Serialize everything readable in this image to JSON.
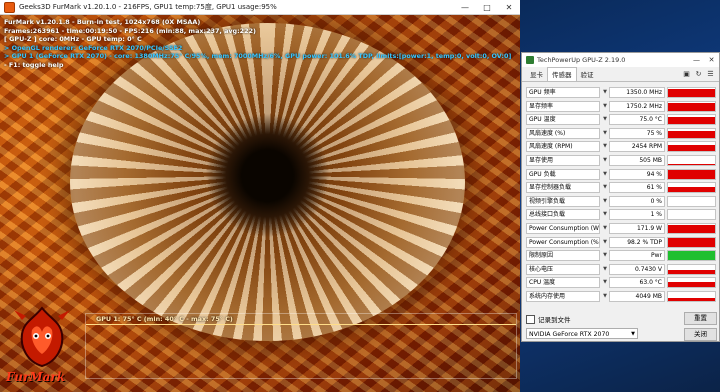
{
  "furmark": {
    "window_title": "Geeks3D FurMark v1.20.1.0 - 216FPS, GPU1 temp:75度, GPU1 usage:95%",
    "hud": [
      {
        "text": "FurMark v1.20.1.8 - Burn-in test, 1024x768 (0X MSAA)",
        "color": "white"
      },
      {
        "text": "Frames:263961 - time:00:19:50 - FPS:216 (min:88, max:237, avg:222)",
        "color": "white"
      },
      {
        "text": "[ GPU-Z ] core: 0MHz - GPU temp: 0° C",
        "color": "white"
      },
      {
        "text": "> OpenGL renderer: GeForce RTX 2070/PCIe/SSE2",
        "color": "cyan"
      },
      {
        "text": "> GPU 1 (GeForce RTX 2070) - core: 1380MHz:75° C/95%, mem: 7000MHz/6%, GPU power: 101.6% TDP, limits:[power:1, temp:0, volt:0, OV:0]",
        "color": "cyan"
      },
      {
        "text": "- F1: toggle help",
        "color": "white"
      }
    ],
    "graph_label": "GPU 1: 75° C (min: 40° C - max: 75° C)",
    "logo_text": "FurMark",
    "accent": "#e85b10"
  },
  "gpuz": {
    "window_title": "TechPowerUp GPU-Z 2.19.0",
    "tabs": [
      {
        "label": "显卡",
        "active": false
      },
      {
        "label": "传感器",
        "active": true
      },
      {
        "label": "验证",
        "active": false
      }
    ],
    "tool_icons": [
      "camera-icon",
      "refresh-icon",
      "menu-icon"
    ],
    "sensors": [
      {
        "label": "GPU 频率",
        "value": "1350.0 MHz",
        "fill": 0.85,
        "color": "#e00000"
      },
      {
        "label": "显存频率",
        "value": "1750.2 MHz",
        "fill": 0.9,
        "color": "#e00000"
      },
      {
        "label": "GPU 温度",
        "value": "75.0 °C",
        "fill": 0.75,
        "color": "#e00000"
      },
      {
        "label": "风扇速度 (%)",
        "value": "75 %",
        "fill": 0.75,
        "color": "#e00000"
      },
      {
        "label": "风扇速度 (RPM)",
        "value": "2454 RPM",
        "fill": 0.7,
        "color": "#e00000"
      },
      {
        "label": "显存使用",
        "value": "505 MB",
        "fill": 0.06,
        "color": "#e00000"
      },
      {
        "label": "GPU 负载",
        "value": "94 %",
        "fill": 0.94,
        "color": "#e00000"
      },
      {
        "label": "显存控制器负载",
        "value": "61 %",
        "fill": 0.61,
        "color": "#e00000"
      },
      {
        "label": "视频引擎负载",
        "value": "0 %",
        "fill": 0.0,
        "color": "#e00000"
      },
      {
        "label": "总线接口负载",
        "value": "1 %",
        "fill": 0.02,
        "color": "#e00000"
      },
      {
        "label": "Power Consumption (W)",
        "value": "171.9 W",
        "fill": 0.85,
        "color": "#e00000"
      },
      {
        "label": "Power Consumption (%)",
        "value": "98.2 % TDP",
        "fill": 0.95,
        "color": "#e00000"
      },
      {
        "label": "限制原因",
        "value": "Pwr",
        "fill": 1.0,
        "color": "#1fbf2f"
      },
      {
        "label": "核心电压",
        "value": "0.7430 V",
        "fill": 0.45,
        "color": "#e00000"
      },
      {
        "label": "CPU 温度",
        "value": "63.0 °C",
        "fill": 0.6,
        "color": "#e00000"
      },
      {
        "label": "系统内存使用",
        "value": "4049 MB",
        "fill": 0.3,
        "color": "#e00000"
      }
    ],
    "log_label": "记录到文件",
    "reset_label": "重置",
    "gpu_select": "NVIDIA GeForce RTX 2070",
    "close_label": "关闭"
  }
}
